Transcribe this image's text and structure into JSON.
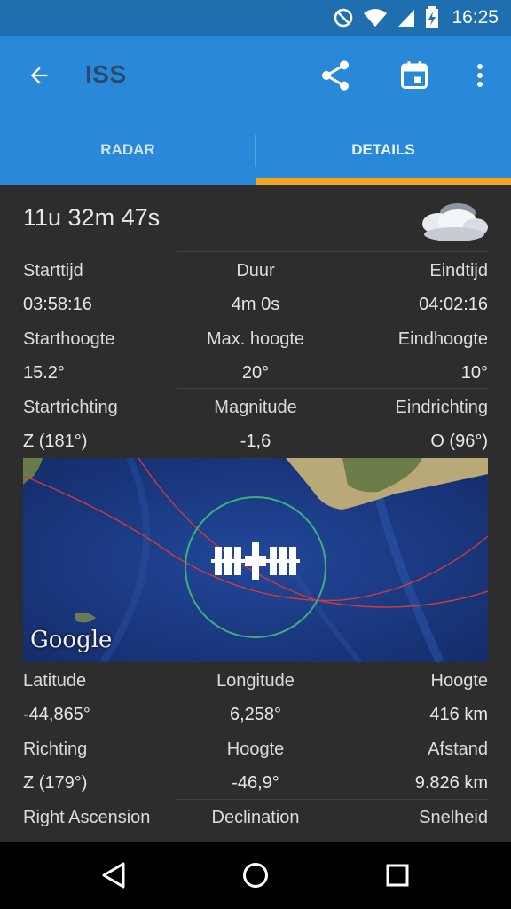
{
  "status_bar": {
    "time": "16:25",
    "icons": [
      "dnd-icon",
      "wifi-icon",
      "signal-icon",
      "battery-charging-icon"
    ]
  },
  "app_bar": {
    "title": "ISS",
    "actions": [
      "share-icon",
      "calendar-icon",
      "more-vert-icon"
    ],
    "colors": {
      "background": "#2a88d8",
      "title": "#2c4a6e"
    }
  },
  "tabs": {
    "items": [
      {
        "label": "RADAR"
      },
      {
        "label": "DETAILS"
      }
    ],
    "active_index": 1,
    "indicator_color": "#f5a623"
  },
  "details": {
    "countdown": "11u 32m 47s",
    "weather_icon": "cloudy-icon",
    "rows": [
      {
        "labels": [
          "Starttijd",
          "Duur",
          "Eindtijd"
        ],
        "values": [
          "03:58:16",
          "4m 0s",
          "04:02:16"
        ]
      },
      {
        "labels": [
          "Starthoogte",
          "Max. hoogte",
          "Eindhoogte"
        ],
        "values": [
          "15.2°",
          "20°",
          "10°"
        ]
      },
      {
        "labels": [
          "Startrichting",
          "Magnitude",
          "Eindrichting"
        ],
        "values": [
          "Z (181°)",
          "-1,6",
          "O (96°)"
        ]
      }
    ],
    "map": {
      "attribution": "Google",
      "marker": "iss-icon"
    },
    "rows_after_map": [
      {
        "labels": [
          "Latitude",
          "Longitude",
          "Hoogte"
        ],
        "values": [
          "-44,865°",
          "6,258°",
          "416 km"
        ]
      },
      {
        "labels": [
          "Richting",
          "Hoogte",
          "Afstand"
        ],
        "values": [
          "Z (179°)",
          "-46,9°",
          "9.826 km"
        ]
      },
      {
        "labels": [
          "Right Ascension",
          "Declination",
          "Snelheid"
        ],
        "values": []
      }
    ]
  },
  "nav_bar": {
    "buttons": [
      "back-triangle-icon",
      "home-circle-icon",
      "recents-square-icon"
    ]
  }
}
